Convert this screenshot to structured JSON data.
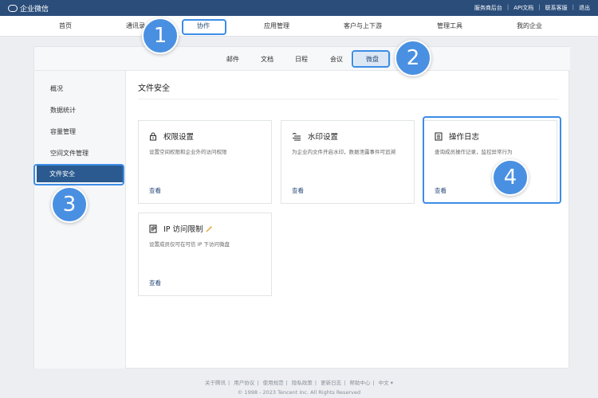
{
  "app": {
    "name": "企业微信"
  },
  "topbar": {
    "links": [
      "服务商后台",
      "API文档",
      "联系客服",
      "退出"
    ]
  },
  "mainnav": {
    "items": [
      "首页",
      "通讯录",
      "协作",
      "应用管理",
      "客户与上下游",
      "管理工具",
      "我的企业"
    ],
    "active": "协作"
  },
  "subnav": {
    "items": [
      "邮件",
      "文档",
      "日程",
      "会议"
    ],
    "active": "微盘"
  },
  "sidebar": {
    "items": [
      "概况",
      "数据统计",
      "容量管理",
      "空间文件管理"
    ],
    "active": "文件安全"
  },
  "section": {
    "title": "文件安全"
  },
  "cards": [
    {
      "title": "权限设置",
      "desc": "设置空间权限和企业外的访问权限",
      "link": "查看",
      "icon": "lock-icon"
    },
    {
      "title": "水印设置",
      "desc": "为企业内文件开启水印，数据泄露事件可追溯",
      "link": "查看",
      "icon": "watermark-icon"
    },
    {
      "title": "操作日志",
      "desc": "查询成员操作记录，监控异常行为",
      "link": "查看",
      "icon": "log-icon"
    },
    {
      "title": "IP 访问限制",
      "desc": "设置成员仅可在可信 IP 下访问微盘",
      "link": "查看",
      "icon": "ip-icon"
    }
  ],
  "annotations": {
    "n1": "1",
    "n2": "2",
    "n3": "3",
    "n4": "4"
  },
  "footer": {
    "links": [
      "关于腾讯",
      "用户协议",
      "使用规范",
      "隐私政策",
      "更新日志",
      "帮助中心",
      "中文 ▾"
    ],
    "copyright": "© 1998 - 2023 Tencent Inc. All Rights Reserved"
  },
  "colors": {
    "topbar": "#2a4d7a",
    "accent": "#3c8de6",
    "badge": "#4a90e2"
  }
}
